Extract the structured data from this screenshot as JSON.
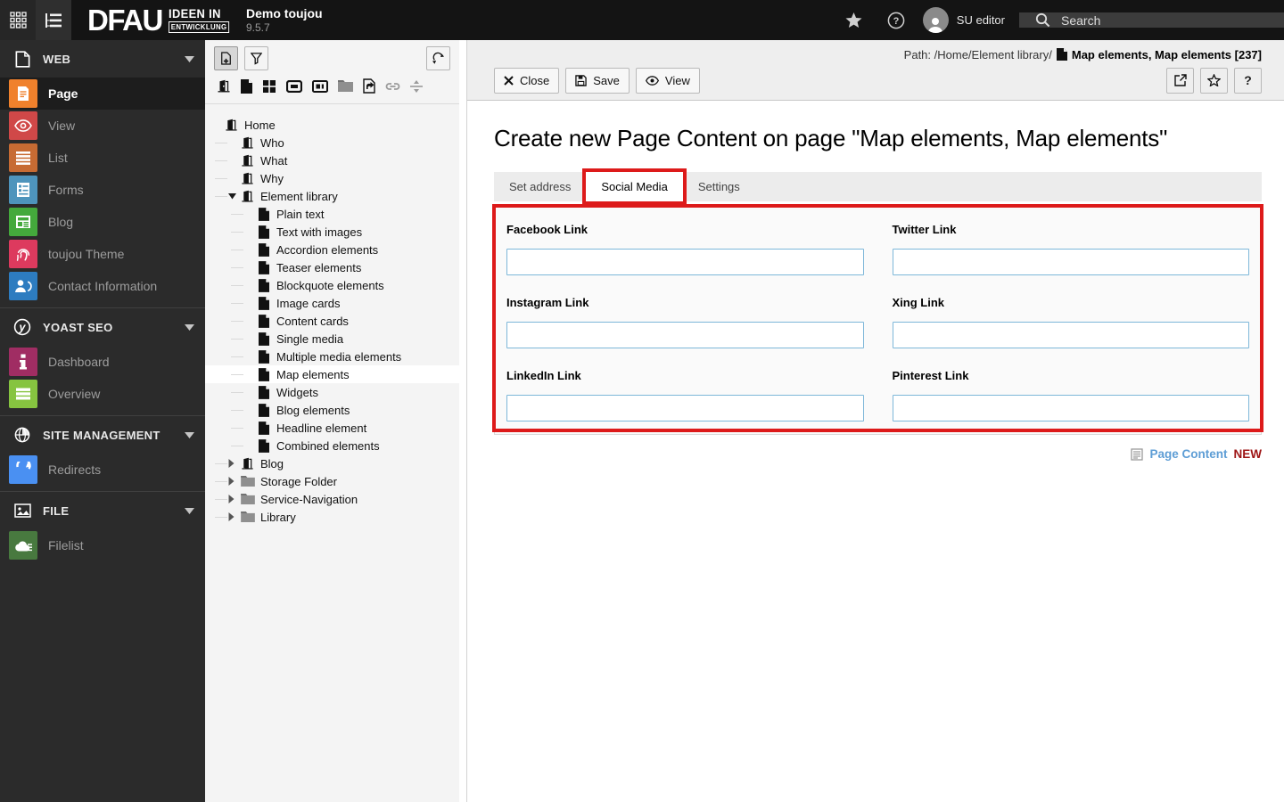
{
  "topbar": {
    "logo_main": "DFAU",
    "logo_sub1": "IDEEN IN",
    "logo_sub2": "ENTWICKLUNG",
    "site_name": "Demo toujou",
    "version": "9.5.7",
    "username": "SU editor",
    "search_label": "Search"
  },
  "sidebar": {
    "sections": [
      {
        "label": "WEB",
        "icon": "web-section-icon",
        "items": [
          {
            "label": "Page",
            "icon": "page-module-icon",
            "color": "#f0812c",
            "active": true
          },
          {
            "label": "View",
            "icon": "view-eye-icon",
            "color": "#d04848"
          },
          {
            "label": "List",
            "icon": "list-bars-icon",
            "color": "#c76b33"
          },
          {
            "label": "Forms",
            "icon": "forms-icon",
            "color": "#4e94bc"
          },
          {
            "label": "Blog",
            "icon": "blog-news-icon",
            "color": "#44a93c"
          },
          {
            "label": "toujou Theme",
            "icon": "fingerprint-icon",
            "color": "#dd3a5e"
          },
          {
            "label": "Contact Information",
            "icon": "contact-icon",
            "color": "#2d7cc0"
          }
        ]
      },
      {
        "label": "YOAST SEO",
        "icon": "yoast-icon",
        "items": [
          {
            "label": "Dashboard",
            "icon": "info-icon",
            "color": "#a02d63"
          },
          {
            "label": "Overview",
            "icon": "overview-bars-icon",
            "color": "#86c440"
          }
        ]
      },
      {
        "label": "SITE MANAGEMENT",
        "icon": "globe-icon",
        "items": [
          {
            "label": "Redirects",
            "icon": "redirect-icon",
            "color": "#4a90f2"
          }
        ]
      },
      {
        "label": "FILE",
        "icon": "image-icon",
        "items": [
          {
            "label": "Filelist",
            "icon": "filelist-icon",
            "color": "#48793f"
          }
        ]
      }
    ]
  },
  "tree": {
    "toolbar_buttons": [
      {
        "icon": "new-page-icon",
        "pressed": true
      },
      {
        "icon": "filter-icon",
        "pressed": false
      }
    ],
    "refresh_icon": "refresh-icon",
    "drag_icons": [
      "door-page-icon",
      "doc-icon",
      "grid4-icon",
      "mountpoint-icon",
      "recycler-icon",
      "folder-gray-icon",
      "shortcut-icon",
      "link-icon",
      "divider-icon"
    ],
    "items": [
      {
        "label": "Home",
        "depth": 0,
        "icon": "page",
        "toggle": "none"
      },
      {
        "label": "Who",
        "depth": 1,
        "icon": "page",
        "toggle": "none"
      },
      {
        "label": "What",
        "depth": 1,
        "icon": "page",
        "toggle": "none"
      },
      {
        "label": "Why",
        "depth": 1,
        "icon": "page",
        "toggle": "none"
      },
      {
        "label": "Element library",
        "depth": 1,
        "icon": "page",
        "toggle": "expanded"
      },
      {
        "label": "Plain text",
        "depth": 2,
        "icon": "doc",
        "toggle": "none"
      },
      {
        "label": "Text with images",
        "depth": 2,
        "icon": "doc",
        "toggle": "none"
      },
      {
        "label": "Accordion elements",
        "depth": 2,
        "icon": "doc",
        "toggle": "none"
      },
      {
        "label": "Teaser elements",
        "depth": 2,
        "icon": "doc",
        "toggle": "none"
      },
      {
        "label": "Blockquote elements",
        "depth": 2,
        "icon": "doc",
        "toggle": "none"
      },
      {
        "label": "Image cards",
        "depth": 2,
        "icon": "doc",
        "toggle": "none"
      },
      {
        "label": "Content cards",
        "depth": 2,
        "icon": "doc",
        "toggle": "none"
      },
      {
        "label": "Single media",
        "depth": 2,
        "icon": "doc",
        "toggle": "none"
      },
      {
        "label": "Multiple media elements",
        "depth": 2,
        "icon": "doc",
        "toggle": "none"
      },
      {
        "label": "Map elements",
        "depth": 2,
        "icon": "doc",
        "toggle": "none",
        "selected": true
      },
      {
        "label": "Widgets",
        "depth": 2,
        "icon": "doc",
        "toggle": "none"
      },
      {
        "label": "Blog elements",
        "depth": 2,
        "icon": "doc",
        "toggle": "none"
      },
      {
        "label": "Headline element",
        "depth": 2,
        "icon": "doc",
        "toggle": "none"
      },
      {
        "label": "Combined elements",
        "depth": 2,
        "icon": "doc",
        "toggle": "none"
      },
      {
        "label": "Blog",
        "depth": 1,
        "icon": "page",
        "toggle": "collapsed"
      },
      {
        "label": "Storage Folder",
        "depth": 1,
        "icon": "folder",
        "toggle": "collapsed"
      },
      {
        "label": "Service-Navigation",
        "depth": 1,
        "icon": "folder",
        "toggle": "collapsed"
      },
      {
        "label": "Library",
        "depth": 1,
        "icon": "folder",
        "toggle": "collapsed"
      }
    ]
  },
  "docheader": {
    "path_label": "Path: /Home/Element library/",
    "record_label": "Map elements, Map elements [237]",
    "close_label": "Close",
    "save_label": "Save",
    "view_label": "View",
    "help_label": "?"
  },
  "main": {
    "title": "Create new Page Content on page \"Map elements, Map elements\"",
    "tabs": [
      {
        "label": "Set address",
        "active": false,
        "annotated": false
      },
      {
        "label": "Social Media",
        "active": true,
        "annotated": true
      },
      {
        "label": "Settings",
        "active": false,
        "annotated": false
      }
    ],
    "fields": [
      {
        "label": "Facebook Link",
        "value": ""
      },
      {
        "label": "Twitter Link",
        "value": ""
      },
      {
        "label": "Instagram Link",
        "value": ""
      },
      {
        "label": "Xing Link",
        "value": ""
      },
      {
        "label": "LinkedIn Link",
        "value": ""
      },
      {
        "label": "Pinterest Link",
        "value": ""
      }
    ],
    "footer_badge": {
      "icon": "content-element-icon",
      "label": "Page Content",
      "status": "NEW"
    }
  },
  "colors": {
    "annotation_red": "#dd1a1a",
    "input_border_blue": "#7db7d9",
    "badge_link_blue": "#5d9dd5",
    "badge_new_red": "#9e1515",
    "topbar_bg": "#141414",
    "sidebar_bg": "#2b2b2b",
    "tree_bg": "#f4f4f4",
    "docheader_bg": "#eeeeee"
  }
}
